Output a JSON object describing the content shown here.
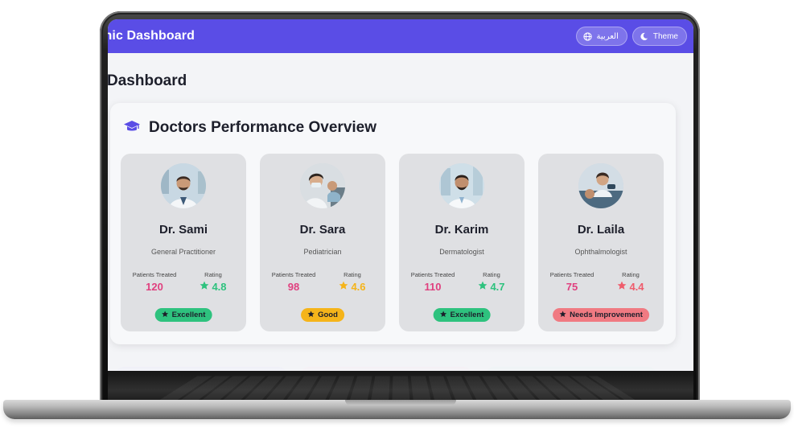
{
  "header": {
    "title": "inic Dashboard",
    "language_label": "العربية",
    "theme_label": "Theme"
  },
  "page": {
    "title": "Dashboard"
  },
  "panel": {
    "title": "Doctors Performance Overview",
    "icon": "graduation-cap-icon"
  },
  "labels": {
    "patients_treated": "Patients Treated",
    "rating": "Rating"
  },
  "doctors": [
    {
      "name": "Dr. Sami",
      "specialty": "General Practitioner",
      "patients": "120",
      "rating": "4.8",
      "rating_color": "#2ec27e",
      "badge": "Excellent",
      "badge_color": "#2ec27e"
    },
    {
      "name": "Dr. Sara",
      "specialty": "Pediatrician",
      "patients": "98",
      "rating": "4.6",
      "rating_color": "#f5b41a",
      "badge": "Good",
      "badge_color": "#f5b41a"
    },
    {
      "name": "Dr. Karim",
      "specialty": "Dermatologist",
      "patients": "110",
      "rating": "4.7",
      "rating_color": "#2ec27e",
      "badge": "Excellent",
      "badge_color": "#2ec27e"
    },
    {
      "name": "Dr. Laila",
      "specialty": "Ophthalmologist",
      "patients": "75",
      "rating": "4.4",
      "rating_color": "#ef5c6c",
      "badge": "Needs Improvement",
      "badge_color": "#f07a82"
    }
  ],
  "colors": {
    "accent": "#5a4de6",
    "patients_value": "#e0407f"
  }
}
